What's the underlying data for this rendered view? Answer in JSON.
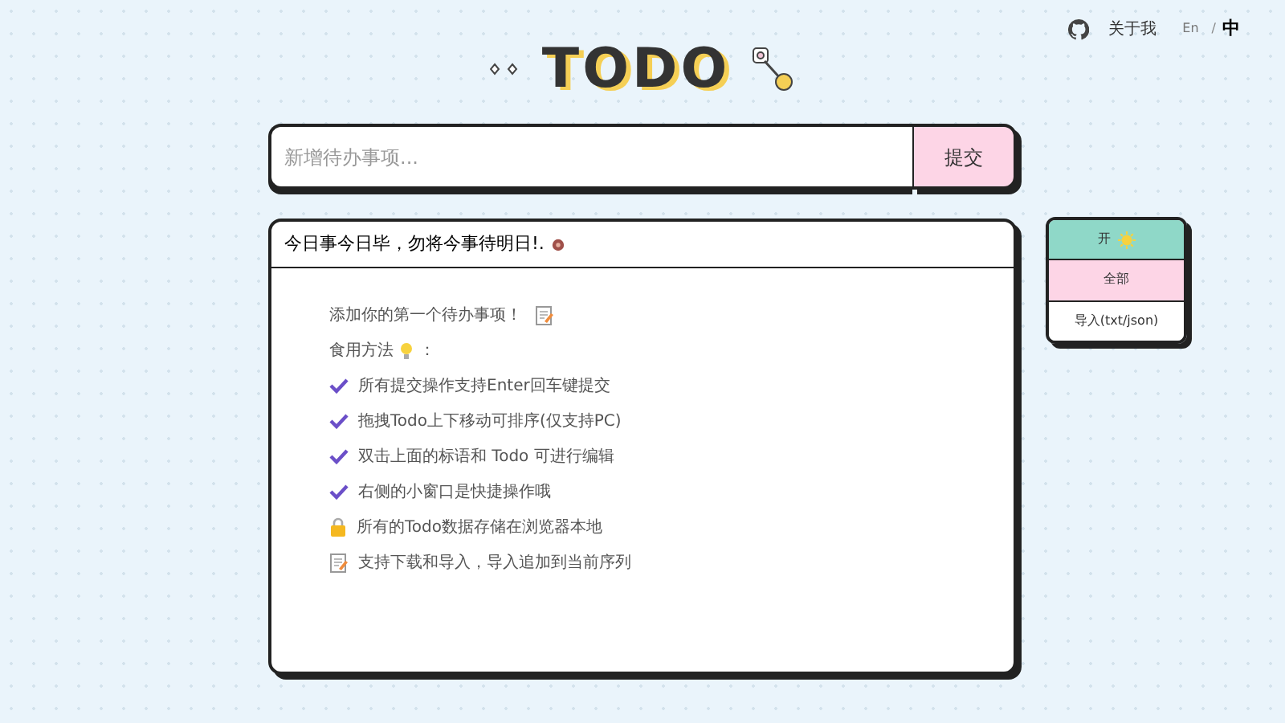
{
  "header": {
    "about": "关于我",
    "languages": [
      {
        "label": "En",
        "selected": false
      },
      {
        "label": "中",
        "selected": true
      }
    ],
    "separator": "/"
  },
  "logo": "TODO",
  "new_todo": {
    "placeholder": "新增待办事项...",
    "submit": "提交"
  },
  "motto": "今日事今日毕，勿将今事待明日!.",
  "intro": {
    "title": "添加你的第一个待办事项！",
    "usage": "食用方法",
    "usage_colon": "：",
    "tips": [
      {
        "kind": "check",
        "text": "所有提交操作支持Enter回车键提交"
      },
      {
        "kind": "check",
        "text": "拖拽Todo上下移动可排序(仅支持PC)"
      },
      {
        "kind": "check",
        "text": "双击上面的标语和 Todo 可进行编辑"
      },
      {
        "kind": "check",
        "text": "右侧的小窗口是快捷操作哦"
      },
      {
        "kind": "lock",
        "text": "所有的Todo数据存储在浏览器本地"
      },
      {
        "kind": "memo",
        "text": "支持下载和导入，导入追加到当前序列"
      }
    ]
  },
  "side_menu": [
    {
      "label": "开",
      "kind": "theme"
    },
    {
      "label": "全部",
      "kind": "filter"
    },
    {
      "label": "导入(txt/json)",
      "kind": "import"
    }
  ]
}
